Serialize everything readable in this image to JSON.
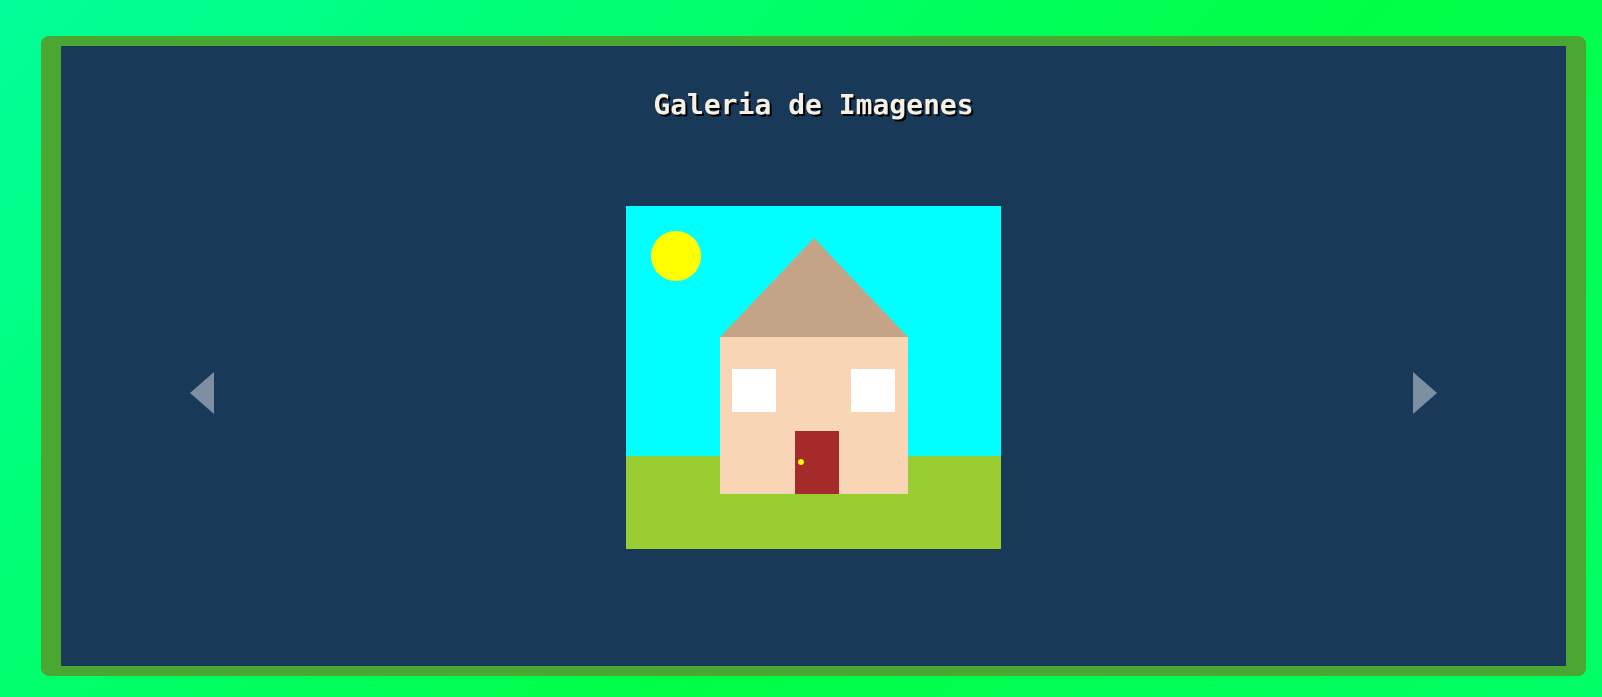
{
  "gallery": {
    "title": "Galeria de Imagenes"
  },
  "navigation": {
    "prev_icon": "triangle-left-icon",
    "next_icon": "triangle-right-icon"
  },
  "picture": {
    "subject": "house-drawing",
    "colors": {
      "sky": "#00ffff",
      "sun": "#ffff00",
      "roof": "#c4a487",
      "walls": "#f8d5b4",
      "windows": "#ffffff",
      "door": "#a52a2a",
      "doorknob": "#ffff00",
      "grass": "#9acd32"
    }
  },
  "theme": {
    "background": "#00ff66",
    "frame": "#4aa832",
    "panel": "#183a58",
    "title_text": "#f5f0e6",
    "arrow": "#7e8ea3"
  }
}
